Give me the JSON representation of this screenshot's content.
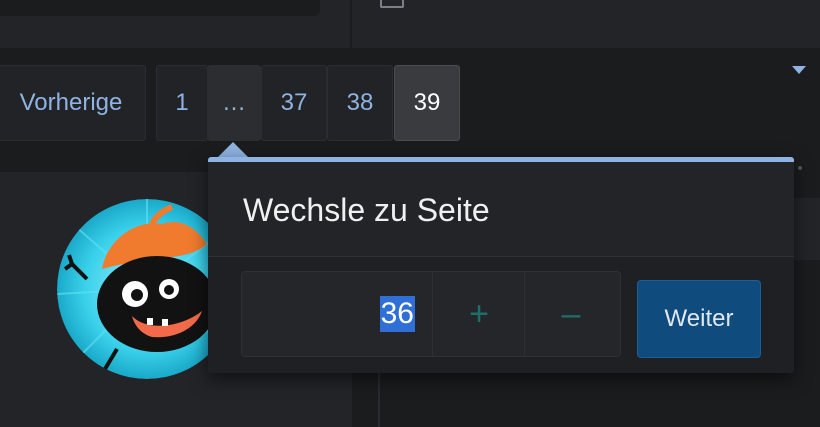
{
  "pagination": {
    "prev_label": "Vorherige",
    "pages": [
      "1",
      "…",
      "37",
      "38",
      "39"
    ],
    "current_page": "39"
  },
  "jump_popup": {
    "title": "Wechsle zu Seite",
    "page_value": "36",
    "plus_symbol": "+",
    "minus_symbol": "–",
    "submit_label": "Weiter"
  },
  "colors": {
    "accent": "#8fb3e2",
    "submit_bg": "#0f4c7d",
    "stepper_symbol": "#1e6f6b",
    "background": "#1b1c1e"
  }
}
